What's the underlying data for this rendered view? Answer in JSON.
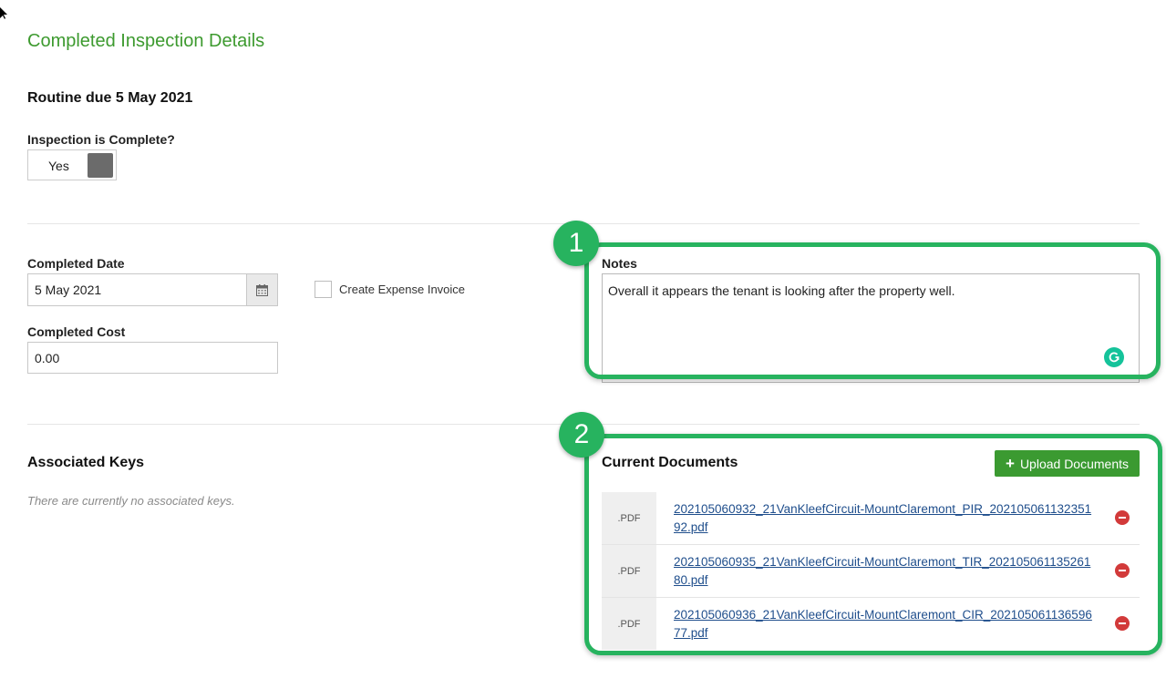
{
  "page": {
    "title": "Completed Inspection Details",
    "section_title": "Routine due 5 May 2021"
  },
  "inspection_complete": {
    "label": "Inspection is Complete?",
    "value": "Yes"
  },
  "completed_date": {
    "label": "Completed Date",
    "value": "5 May 2021",
    "icon": "calendar-icon"
  },
  "create_expense_invoice": {
    "label": "Create Expense Invoice",
    "checked": false
  },
  "completed_cost": {
    "label": "Completed Cost",
    "value": "0.00"
  },
  "notes": {
    "label": "Notes",
    "value": "Overall it appears the tenant is looking after the property well."
  },
  "callouts": {
    "one": "1",
    "two": "2",
    "color": "#27b35f"
  },
  "associated_keys": {
    "title": "Associated Keys",
    "empty_text": "There are currently no associated keys."
  },
  "documents": {
    "title": "Current Documents",
    "upload_label": "Upload Documents",
    "items": [
      {
        "type": ".PDF",
        "name": "202105060932_21VanKleefCircuit-MountClaremont_PIR_20210506113235192.pdf"
      },
      {
        "type": ".PDF",
        "name": "202105060935_21VanKleefCircuit-MountClaremont_TIR_20210506113526180.pdf"
      },
      {
        "type": ".PDF",
        "name": "202105060936_21VanKleefCircuit-MountClaremont_CIR_20210506113659677.pdf"
      }
    ]
  },
  "colors": {
    "title_green": "#3d9a2f",
    "button_green": "#3b9a31",
    "link_blue": "#1f4e8c",
    "remove_red": "#d23a3a"
  }
}
